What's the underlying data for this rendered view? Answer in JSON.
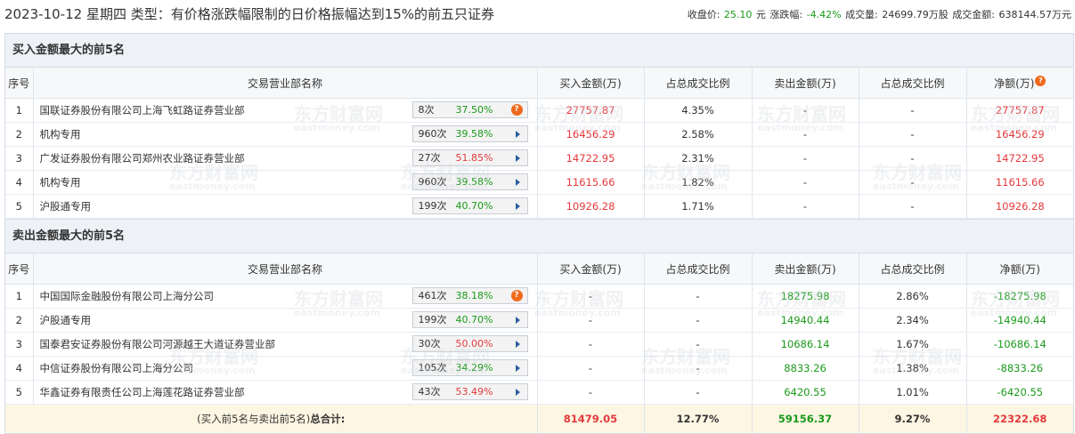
{
  "header": {
    "title": "2023-10-12 星期四 类型：有价格涨跌幅限制的日价格振幅达到15%的前五只证券",
    "close_label": "收盘价:",
    "close_value": "25.10",
    "close_unit": "元",
    "change_label": "涨跌幅:",
    "change_value": "-4.42%",
    "volume_label": "成交量:",
    "volume_value": "24699.79万股",
    "turnover_label": "成交金额:",
    "turnover_value": "638144.57万元"
  },
  "buy": {
    "section_title": "买入金额最大的前5名",
    "columns": [
      "序号",
      "交易营业部名称",
      "买入金额(万)",
      "占总成交比例",
      "卖出金额(万)",
      "占总成交比例",
      "净额(万)"
    ],
    "rows": [
      {
        "idx": "1",
        "name": "国联证券股份有限公司上海飞虹路证券营业部",
        "count": "8次",
        "pct": "37.50%",
        "pct_color": "green",
        "icon": "question-icon",
        "buy": "27757.87",
        "buy_ratio": "4.35%",
        "sell": "-",
        "sell_ratio": "-",
        "net": "27757.87"
      },
      {
        "idx": "2",
        "name": "机构专用",
        "count": "960次",
        "pct": "39.58%",
        "pct_color": "green",
        "icon": "arrow-right-icon",
        "buy": "16456.29",
        "buy_ratio": "2.58%",
        "sell": "-",
        "sell_ratio": "-",
        "net": "16456.29"
      },
      {
        "idx": "3",
        "name": "广发证券股份有限公司郑州农业路证券营业部",
        "count": "27次",
        "pct": "51.85%",
        "pct_color": "red",
        "icon": "arrow-right-icon",
        "buy": "14722.95",
        "buy_ratio": "2.31%",
        "sell": "-",
        "sell_ratio": "-",
        "net": "14722.95"
      },
      {
        "idx": "4",
        "name": "机构专用",
        "count": "960次",
        "pct": "39.58%",
        "pct_color": "green",
        "icon": "arrow-right-icon",
        "buy": "11615.66",
        "buy_ratio": "1.82%",
        "sell": "-",
        "sell_ratio": "-",
        "net": "11615.66"
      },
      {
        "idx": "5",
        "name": "沪股通专用",
        "count": "199次",
        "pct": "40.70%",
        "pct_color": "green",
        "icon": "arrow-right-icon",
        "buy": "10926.28",
        "buy_ratio": "1.71%",
        "sell": "-",
        "sell_ratio": "-",
        "net": "10926.28"
      }
    ]
  },
  "sell": {
    "section_title": "卖出金额最大的前5名",
    "columns": [
      "序号",
      "交易营业部名称",
      "买入金额(万)",
      "占总成交比例",
      "卖出金额(万)",
      "占总成交比例",
      "净额(万)"
    ],
    "rows": [
      {
        "idx": "1",
        "name": "中国国际金融股份有限公司上海分公司",
        "count": "461次",
        "pct": "38.18%",
        "pct_color": "green",
        "icon": "question-icon",
        "buy": "-",
        "buy_ratio": "-",
        "sell": "18275.98",
        "sell_ratio": "2.86%",
        "net": "-18275.98"
      },
      {
        "idx": "2",
        "name": "沪股通专用",
        "count": "199次",
        "pct": "40.70%",
        "pct_color": "green",
        "icon": "arrow-right-icon",
        "buy": "-",
        "buy_ratio": "-",
        "sell": "14940.44",
        "sell_ratio": "2.34%",
        "net": "-14940.44"
      },
      {
        "idx": "3",
        "name": "国泰君安证券股份有限公司河源越王大道证券营业部",
        "count": "30次",
        "pct": "50.00%",
        "pct_color": "red",
        "icon": "arrow-right-icon",
        "buy": "-",
        "buy_ratio": "-",
        "sell": "10686.14",
        "sell_ratio": "1.67%",
        "net": "-10686.14"
      },
      {
        "idx": "4",
        "name": "中信证券股份有限公司上海分公司",
        "count": "105次",
        "pct": "34.29%",
        "pct_color": "green",
        "icon": "arrow-right-icon",
        "buy": "-",
        "buy_ratio": "-",
        "sell": "8833.26",
        "sell_ratio": "1.38%",
        "net": "-8833.26"
      },
      {
        "idx": "5",
        "name": "华鑫证券有限责任公司上海莲花路证券营业部",
        "count": "43次",
        "pct": "53.49%",
        "pct_color": "red",
        "icon": "arrow-right-icon",
        "buy": "-",
        "buy_ratio": "-",
        "sell": "6420.55",
        "sell_ratio": "1.01%",
        "net": "-6420.55"
      }
    ],
    "total": {
      "label_prefix": "(买入前5名与卖出前5名)",
      "label_bold": "总合计:",
      "buy": "81479.05",
      "buy_ratio": "12.77%",
      "sell": "59156.37",
      "sell_ratio": "9.27%",
      "net": "22322.68"
    }
  },
  "colors": {
    "red": "#e4393c",
    "green": "#1b9a1b",
    "header_bg": "#eef2f7",
    "total_bg": "#fdf6e3"
  },
  "watermark": {
    "cn": "东方财富网",
    "en": "eastmoney.com"
  }
}
